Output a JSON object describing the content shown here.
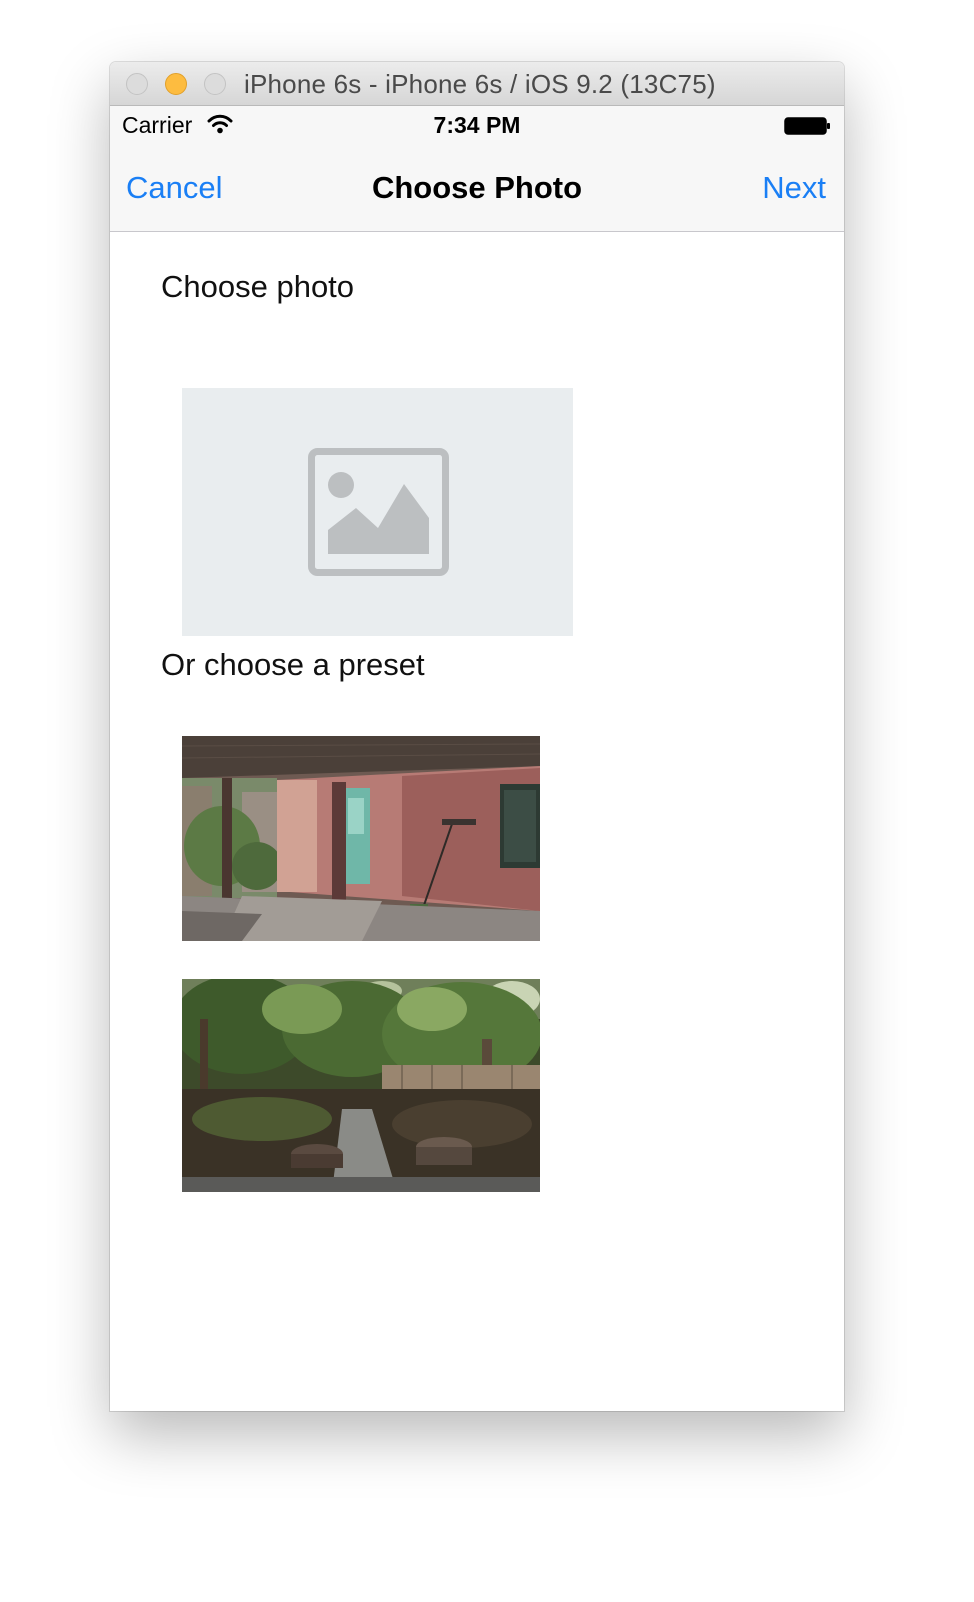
{
  "window": {
    "title": "iPhone 6s - iPhone 6s / iOS 9.2 (13C75)"
  },
  "statusbar": {
    "carrier": "Carrier",
    "time": "7:34 PM",
    "icons": [
      "wifi-icon",
      "battery-icon"
    ]
  },
  "navbar": {
    "cancel_label": "Cancel",
    "title": "Choose Photo",
    "next_label": "Next"
  },
  "content": {
    "choose_heading": "Choose photo",
    "placeholder_icon": "image-placeholder-icon",
    "preset_heading": "Or choose a preset",
    "presets": [
      "preset-photo-porch",
      "preset-photo-garden"
    ]
  },
  "colors": {
    "accent": "#1a7ff5",
    "placeholder_bg": "#e9edef",
    "placeholder_icon": "#bcbfc1",
    "minimize_button": "#fdbc40"
  }
}
